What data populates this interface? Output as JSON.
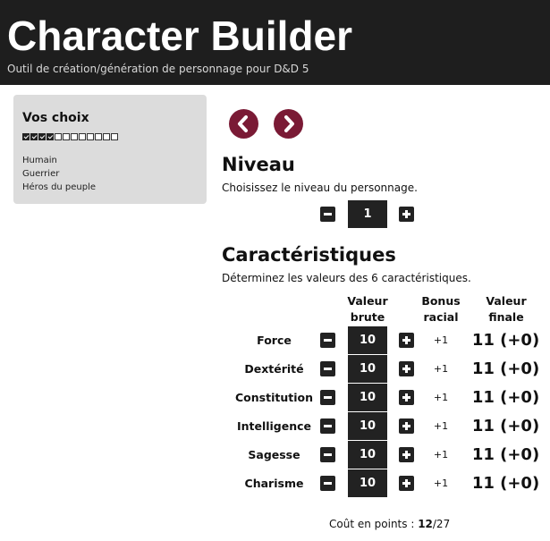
{
  "header": {
    "title": "Character Builder",
    "subtitle": "Outil de création/génération de personnage pour D&D 5"
  },
  "sidebar": {
    "title": "Vos choix",
    "progress": {
      "completed": 4,
      "total": 12
    },
    "choices": [
      "Humain",
      "Guerrier",
      "Héros du peuple"
    ]
  },
  "nav": {
    "prev_icon": "chevron-left-icon",
    "next_icon": "chevron-right-icon",
    "accent": "#7a1a35"
  },
  "level": {
    "title": "Niveau",
    "description": "Choisissez le niveau du personnage.",
    "value": "1"
  },
  "abilities": {
    "title": "Caractéristiques",
    "description": "Déterminez les valeurs des 6 caractéristiques.",
    "headers": {
      "raw_1": "Valeur",
      "raw_2": "brute",
      "bonus_1": "Bonus",
      "bonus_2": "racial",
      "final_1": "Valeur",
      "final_2": "finale"
    },
    "rows": [
      {
        "name": "Force",
        "raw": "10",
        "bonus": "+1",
        "final": "11 (+0)"
      },
      {
        "name": "Dextérité",
        "raw": "10",
        "bonus": "+1",
        "final": "11 (+0)"
      },
      {
        "name": "Constitution",
        "raw": "10",
        "bonus": "+1",
        "final": "11 (+0)"
      },
      {
        "name": "Intelligence",
        "raw": "10",
        "bonus": "+1",
        "final": "11 (+0)"
      },
      {
        "name": "Sagesse",
        "raw": "10",
        "bonus": "+1",
        "final": "11 (+0)"
      },
      {
        "name": "Charisme",
        "raw": "10",
        "bonus": "+1",
        "final": "11 (+0)"
      }
    ]
  },
  "points": {
    "label": "Coût en points : ",
    "used": "12",
    "total": "/27"
  }
}
